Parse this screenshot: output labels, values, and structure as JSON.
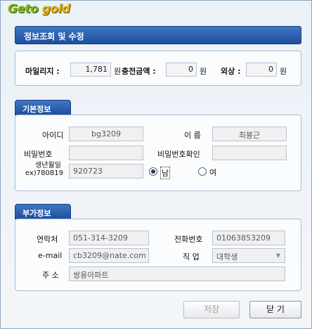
{
  "logo": {
    "part1": "Geto",
    "part2": "gold"
  },
  "title": "정보조회 및 수정",
  "mileage": {
    "mileage_label": "마일리지 :",
    "mileage_value": "1,781",
    "mileage_unit": "원",
    "charge_label": "충전금액 :",
    "charge_value": "0",
    "charge_unit": "원",
    "credit_label": "외상 :",
    "credit_value": "0",
    "credit_unit": "원"
  },
  "basic": {
    "section_title": "기본정보",
    "id_label": "아이디",
    "id_value": "bg3209",
    "name_label": "이 름",
    "name_value": "최봉근",
    "password_label": "비밀번호",
    "password_value": "",
    "password_confirm_label": "비밀번호확인",
    "password_confirm_value": "",
    "birth_label_line1": "생년월일",
    "birth_label_line2": "ex)780819",
    "birth_value": "920723",
    "gender_male": "남",
    "gender_female": "여",
    "gender_selected": "남"
  },
  "extra": {
    "section_title": "부가정보",
    "contact_label": "연락처",
    "contact_value": "051-314-3209",
    "phone_label": "전화번호",
    "phone_value": "01063853209",
    "email_label": "e-mail",
    "email_value": "cb3209@nate.com",
    "job_label": "직 업",
    "job_value": "대학생",
    "address_label": "주 소",
    "address_value": "쌍용아파트"
  },
  "buttons": {
    "save": "저장",
    "close": "닫 기"
  },
  "icons": {
    "select_arrow": "chevron-down-icon"
  }
}
